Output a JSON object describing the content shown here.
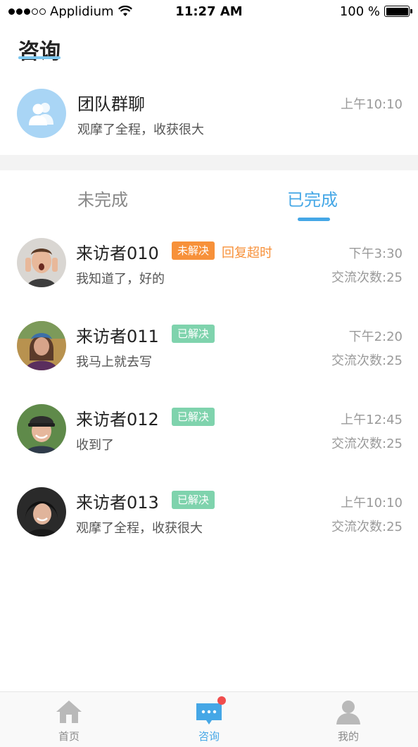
{
  "status_bar": {
    "carrier": "Applidium",
    "time": "11:27 AM",
    "battery": "100 %"
  },
  "header": {
    "title": "咨询"
  },
  "group_chat": {
    "name": "团队群聊",
    "message": "观摩了全程，收获很大",
    "time": "上午10:10",
    "icon": "group-people-icon"
  },
  "tabs": [
    {
      "label": "未完成",
      "active": false
    },
    {
      "label": "已完成",
      "active": true
    }
  ],
  "visitors": [
    {
      "name": "来访者010",
      "badge": "未解决",
      "status": "unsolved",
      "overtime": "回复超时",
      "time": "下午3:30",
      "message": "我知道了，好的",
      "count": "交流次数:25"
    },
    {
      "name": "来访者011",
      "badge": "已解决",
      "status": "solved",
      "overtime": "",
      "time": "下午2:20",
      "message": "我马上就去写",
      "count": "交流次数:25"
    },
    {
      "name": "来访者012",
      "badge": "已解决",
      "status": "solved",
      "overtime": "",
      "time": "上午12:45",
      "message": "收到了",
      "count": "交流次数:25"
    },
    {
      "name": "来访者013",
      "badge": "已解决",
      "status": "solved",
      "overtime": "",
      "time": "上午10:10",
      "message": "观摩了全程，收获很大",
      "count": "交流次数:25"
    }
  ],
  "tabbar": {
    "items": [
      {
        "label": "首页",
        "icon": "home-icon"
      },
      {
        "label": "咨询",
        "icon": "chat-bubble-icon",
        "active": true,
        "notify": true
      },
      {
        "label": "我的",
        "icon": "person-icon"
      }
    ]
  },
  "colors": {
    "accent": "#45a7e6",
    "unsolved": "#f7913a",
    "solved": "#7fd3ad"
  }
}
